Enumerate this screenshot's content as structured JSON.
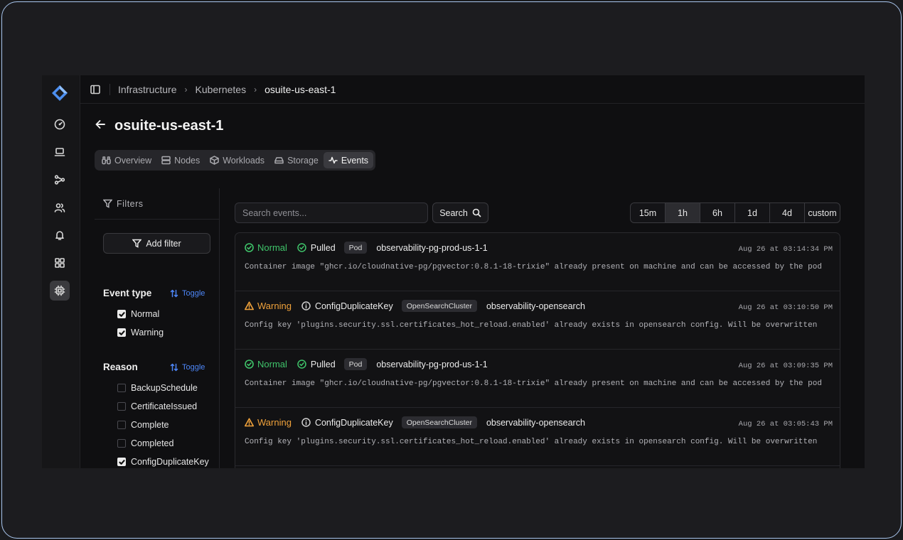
{
  "breadcrumb": [
    "Infrastructure",
    "Kubernetes",
    "osuite-us-east-1"
  ],
  "page_title": "osuite-us-east-1",
  "tabs": [
    {
      "label": "Overview",
      "icon": "binoculars-icon"
    },
    {
      "label": "Nodes",
      "icon": "server-icon"
    },
    {
      "label": "Workloads",
      "icon": "box-icon"
    },
    {
      "label": "Storage",
      "icon": "hard-drive-icon"
    },
    {
      "label": "Events",
      "icon": "activity-icon",
      "active": true
    }
  ],
  "filters": {
    "title": "Filters",
    "add_filter": "Add filter",
    "toggle_label": "Toggle",
    "event_type": {
      "title": "Event type",
      "options": [
        {
          "label": "Normal",
          "checked": true
        },
        {
          "label": "Warning",
          "checked": true
        }
      ]
    },
    "reason": {
      "title": "Reason",
      "options": [
        {
          "label": "BackupSchedule",
          "checked": false
        },
        {
          "label": "CertificateIssued",
          "checked": false
        },
        {
          "label": "Complete",
          "checked": false
        },
        {
          "label": "Completed",
          "checked": false
        },
        {
          "label": "ConfigDuplicateKey",
          "checked": true
        }
      ]
    }
  },
  "search": {
    "placeholder": "Search events...",
    "button_label": "Search"
  },
  "time_ranges": [
    {
      "label": "15m",
      "active": false
    },
    {
      "label": "1h",
      "active": true
    },
    {
      "label": "6h",
      "active": false
    },
    {
      "label": "1d",
      "active": false
    },
    {
      "label": "4d",
      "active": false
    },
    {
      "label": "custom",
      "active": false
    }
  ],
  "events": [
    {
      "type": "Normal",
      "reason": "Pulled",
      "kind": "Pod",
      "object": "observability-pg-prod-us-1-1",
      "time": "Aug 26 at 03:14:34 PM",
      "message": "Container image \"ghcr.io/cloudnative-pg/pgvector:0.8.1-18-trixie\" already present on machine and can be accessed by the pod"
    },
    {
      "type": "Warning",
      "reason": "ConfigDuplicateKey",
      "kind": "OpenSearchCluster",
      "object": "observability-opensearch",
      "time": "Aug 26 at 03:10:50 PM",
      "message": "Config key 'plugins.security.ssl.certificates_hot_reload.enabled' already exists in opensearch config. Will be overwritten"
    },
    {
      "type": "Normal",
      "reason": "Pulled",
      "kind": "Pod",
      "object": "observability-pg-prod-us-1-1",
      "time": "Aug 26 at 03:09:35 PM",
      "message": "Container image \"ghcr.io/cloudnative-pg/pgvector:0.8.1-18-trixie\" already present on machine and can be accessed by the pod"
    },
    {
      "type": "Warning",
      "reason": "ConfigDuplicateKey",
      "kind": "OpenSearchCluster",
      "object": "observability-opensearch",
      "time": "Aug 26 at 03:05:43 PM",
      "message": "Config key 'plugins.security.ssl.certificates_hot_reload.enabled' already exists in opensearch config. Will be overwritten"
    }
  ],
  "colors": {
    "normal": "#3fc46a",
    "warning": "#f0a23b",
    "accent": "#4d86f7"
  },
  "rail_icons": [
    "logo-icon",
    "gauge-icon",
    "laptop-icon",
    "workflow-icon",
    "users-icon",
    "bell-icon",
    "grid-icon",
    "cpu-icon"
  ]
}
